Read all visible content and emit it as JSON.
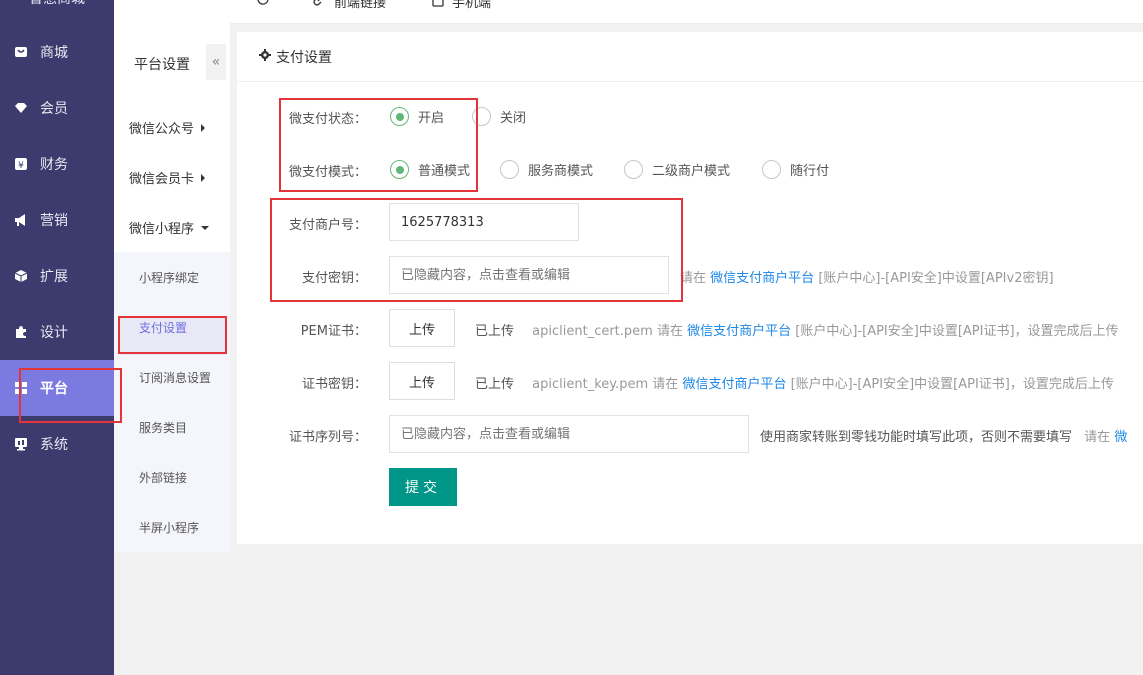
{
  "sidebar": {
    "logo": "智慧商城",
    "items": [
      {
        "label": "商城",
        "icon": "store-icon"
      },
      {
        "label": "会员",
        "icon": "diamond-icon"
      },
      {
        "label": "财务",
        "icon": "yen-icon"
      },
      {
        "label": "营销",
        "icon": "megaphone-icon"
      },
      {
        "label": "扩展",
        "icon": "cube-icon"
      },
      {
        "label": "设计",
        "icon": "puzzle-icon"
      },
      {
        "label": "平台",
        "icon": "grid-icon",
        "active": true
      },
      {
        "label": "系统",
        "icon": "monitor-icon"
      }
    ]
  },
  "topbar": {
    "items": [
      {
        "label": "",
        "icon": "menu-icon"
      },
      {
        "label": "",
        "icon": "fullscreen-icon"
      },
      {
        "label": "",
        "icon": "refresh-icon"
      },
      {
        "label": "前端链接",
        "icon": "link-icon"
      },
      {
        "label": "手机端",
        "icon": "mobile-icon"
      }
    ]
  },
  "submenu": {
    "title": "平台设置",
    "collapse": "«",
    "groups": [
      {
        "label": "微信公众号"
      },
      {
        "label": "微信会员卡"
      },
      {
        "label": "微信小程序"
      }
    ],
    "items": [
      {
        "label": "小程序绑定"
      },
      {
        "label": "支付设置",
        "active": true
      },
      {
        "label": "订阅消息设置"
      },
      {
        "label": "服务类目"
      },
      {
        "label": "外部链接"
      },
      {
        "label": "半屏小程序"
      }
    ]
  },
  "card": {
    "title": "支付设置"
  },
  "form": {
    "status_label": "微支付状态：",
    "status_options": [
      "开启",
      "关闭"
    ],
    "mode_label": "微支付模式：",
    "mode_options": [
      "普通模式",
      "服务商模式",
      "二级商户模式",
      "随行付"
    ],
    "merchant_label": "支付商户号：",
    "merchant_value": "1625778313",
    "key_label": "支付密钥：",
    "key_placeholder": "已隐藏内容，点击查看或编辑",
    "key_hint_pre": "请在",
    "key_hint_link": "微信支付商户平台",
    "key_hint_post": "[账户中心]-[API安全]中设置[APIv2密钥]",
    "pem_label": "PEM证书：",
    "upload_label": "上传",
    "uploaded": "已上传",
    "pem_file": "apiclient_cert.pem",
    "pem_hint_pre": "请在",
    "pem_hint_link": "微信支付商户平台",
    "pem_hint_post": "[账户中心]-[API安全]中设置[API证书]，设置完成后上传",
    "cert_key_label": "证书密钥：",
    "cert_key_file": "apiclient_key.pem",
    "cert_key_hint_pre": "请在",
    "cert_key_hint_link": "微信支付商户平台",
    "cert_key_hint_post": "[账户中心]-[API安全]中设置[API证书]，设置完成后上传",
    "serial_label": "证书序列号：",
    "serial_placeholder": "已隐藏内容，点击查看或编辑",
    "serial_hint": "使用商家转账到零钱功能时填写此项，否则不需要填写",
    "serial_hint2": "请在",
    "serial_hint2_link": "微",
    "submit_label": "提交"
  }
}
